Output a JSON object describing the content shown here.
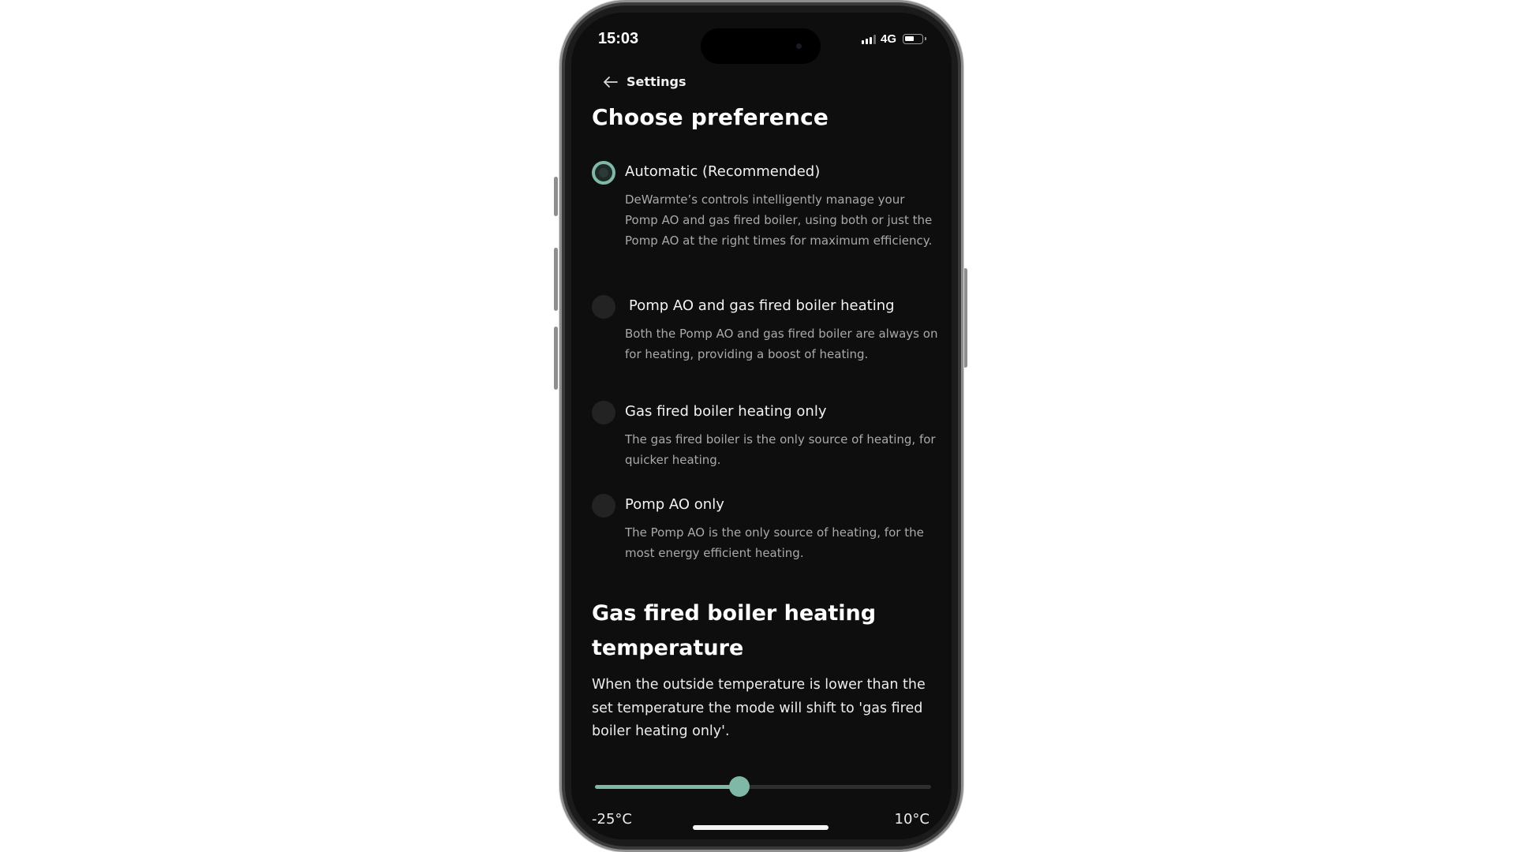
{
  "status_bar": {
    "time": "15:03",
    "network": "4G",
    "battery_level": 0.55
  },
  "nav": {
    "back_label": "Settings"
  },
  "page_title": "Choose preference",
  "options": [
    {
      "label": "Automatic (Recommended)",
      "description": "DeWarmte’s controls intelligently manage your Pomp AO and gas fired boiler, using both or just the Pomp AO at the right times for maximum efficiency.",
      "selected": true
    },
    {
      "label": "Pomp AO and gas fired boiler heating",
      "description": "Both the Pomp AO and gas fired boiler are always on for heating, providing a boost of heating.",
      "selected": false
    },
    {
      "label": "Gas fired boiler heating only",
      "description": "The gas fired boiler is the only source of heating, for quicker heating.",
      "selected": false
    },
    {
      "label": "Pomp AO only",
      "description": "The Pomp AO is the only source of heating, for the most energy efficient heating.",
      "selected": false
    }
  ],
  "temperature_section": {
    "title": "Gas fired boiler heating temperature",
    "description": "When the outside temperature is lower than the set temperature the mode will shift to 'gas fired boiler heating only'.",
    "slider": {
      "min_label": "-25°C",
      "max_label": "10°C",
      "min": -25,
      "max": 10,
      "value": -10
    }
  },
  "colors": {
    "accent": "#7fb8a6",
    "background": "#0e0e0e",
    "text_secondary": "#a9a9a9"
  },
  "icons": {
    "back": "arrow-left-icon"
  }
}
